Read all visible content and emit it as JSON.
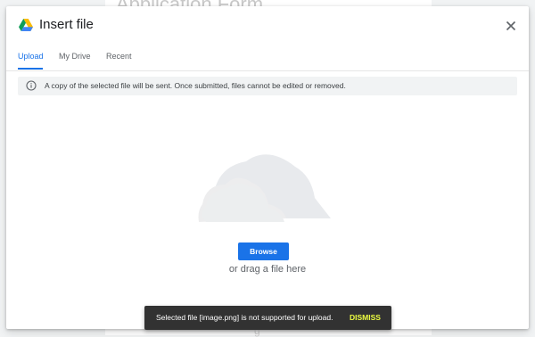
{
  "background": {
    "form_title": "Application Form"
  },
  "dialog": {
    "title": "Insert file",
    "logo_icon": "google-drive-icon",
    "close_icon": "close-icon"
  },
  "tabs": [
    {
      "label": "Upload",
      "active": true
    },
    {
      "label": "My Drive",
      "active": false
    },
    {
      "label": "Recent",
      "active": false
    }
  ],
  "notice": {
    "icon": "info-icon",
    "text": "A copy of the selected file will be sent. Once submitted, files cannot be edited or removed."
  },
  "upload": {
    "illustration": "cloud-icon",
    "browse_label": "Browse",
    "drag_text": "or drag a file here"
  },
  "snackbar": {
    "message": "Selected file [image.png] is not supported for upload.",
    "action_label": "DISMISS"
  },
  "colors": {
    "accent": "#1a73e8",
    "snackbar_action": "#eeff41",
    "snackbar_bg": "#323232"
  }
}
